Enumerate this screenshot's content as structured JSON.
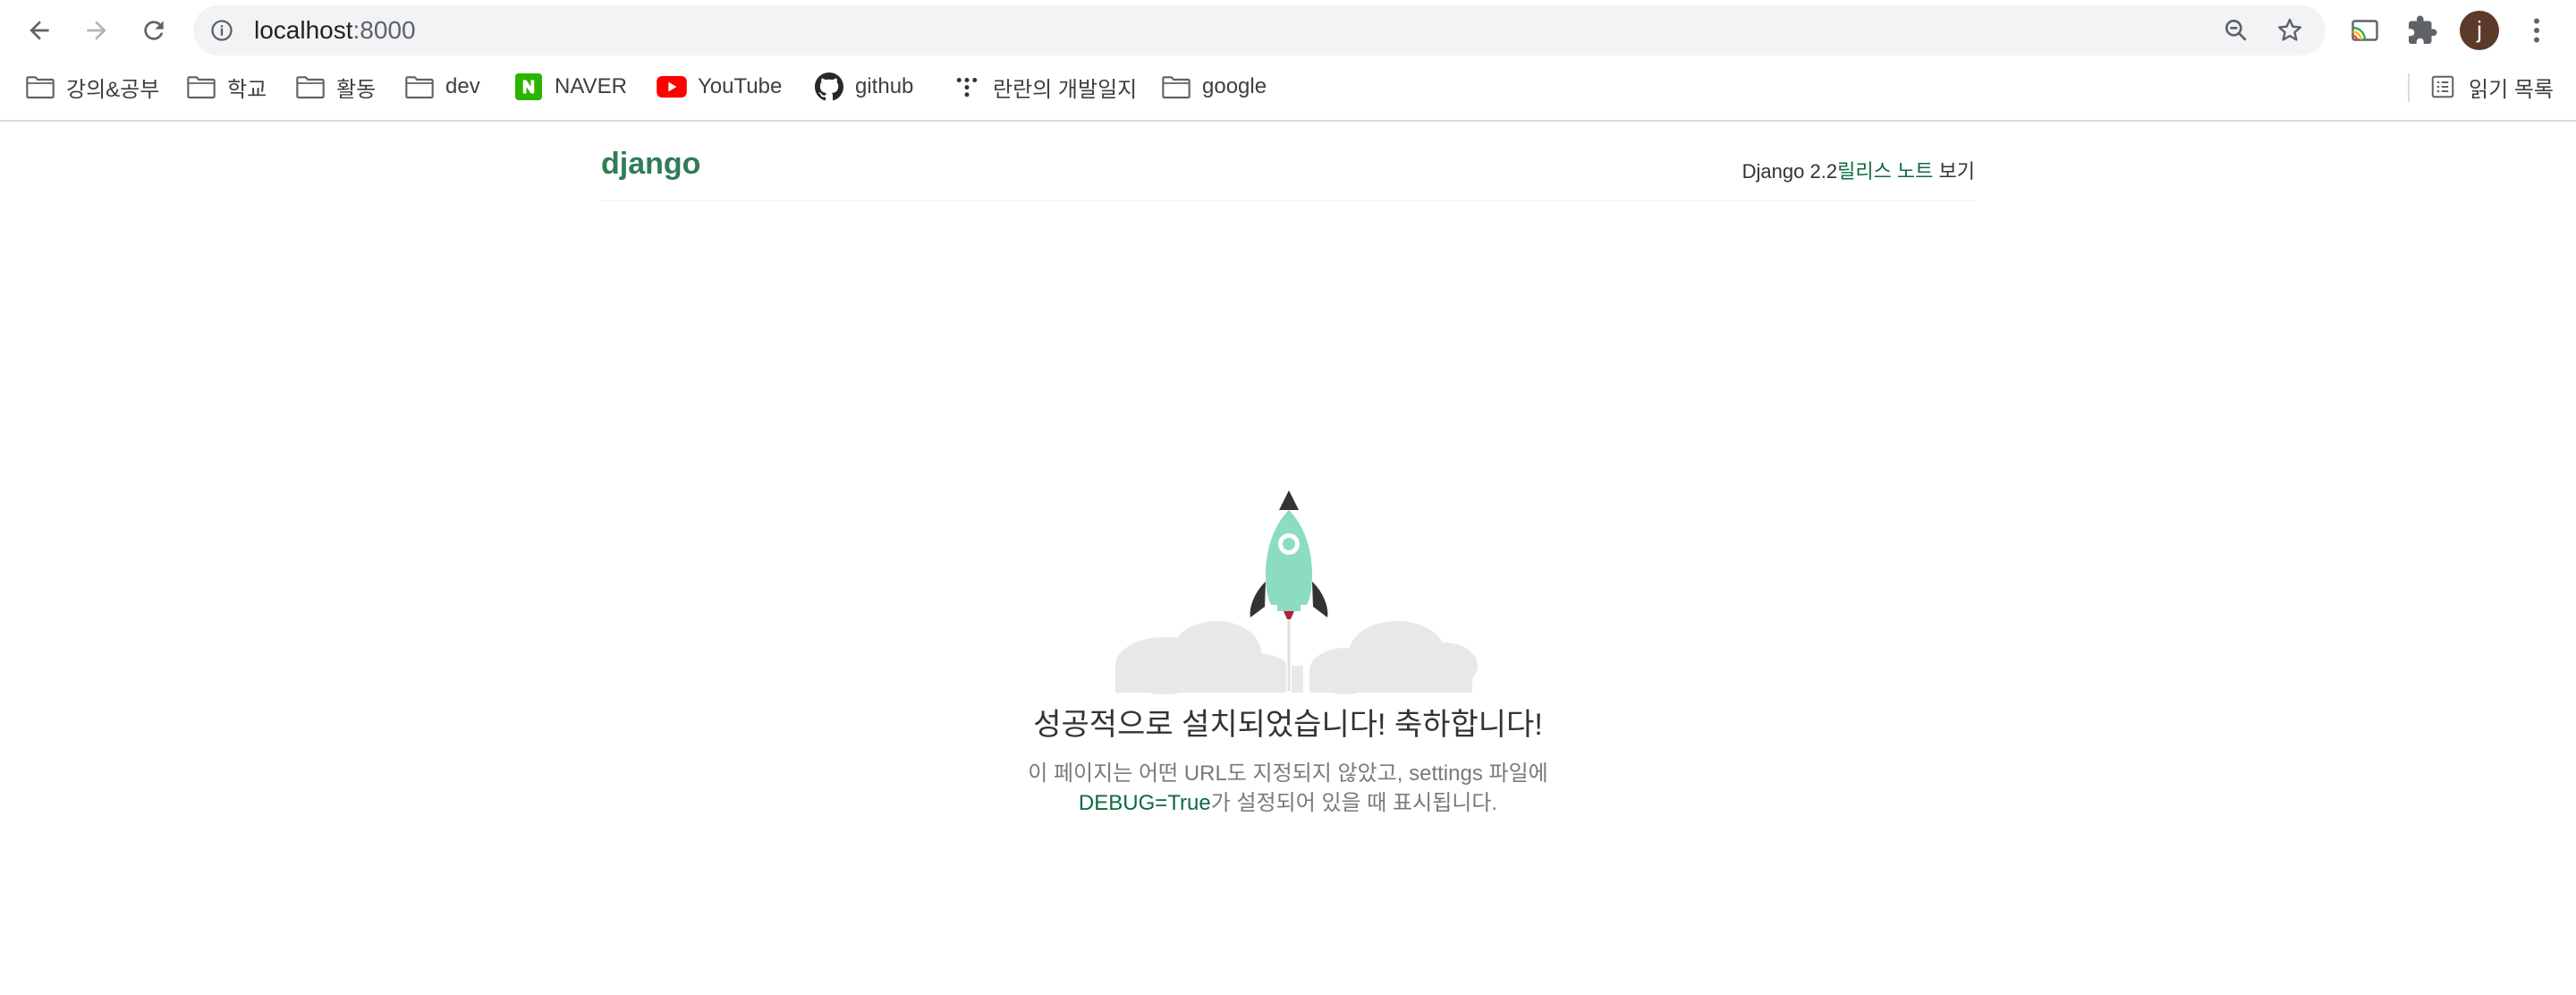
{
  "browser": {
    "url_host": "localhost",
    "url_port": ":8000",
    "avatar_initial": "j",
    "nav_icons": [
      "back-icon",
      "forward-icon",
      "reload-icon"
    ],
    "omnibox_icons": [
      "info-icon",
      "zoom-icon",
      "star-icon"
    ],
    "toolbar_icons": [
      "cast-icon",
      "extensions-icon",
      "menu-icon"
    ]
  },
  "bookmarks": {
    "items": [
      {
        "label": "강의&공부",
        "icon": "folder-icon"
      },
      {
        "label": "학교",
        "icon": "folder-icon"
      },
      {
        "label": "활동",
        "icon": "folder-icon"
      },
      {
        "label": "dev",
        "icon": "folder-icon"
      },
      {
        "label": "NAVER",
        "icon": "naver-icon"
      },
      {
        "label": "YouTube",
        "icon": "youtube-icon"
      },
      {
        "label": "github",
        "icon": "github-icon"
      },
      {
        "label": "란란의 개발일지",
        "icon": "tistory-icon"
      },
      {
        "label": "google",
        "icon": "folder-icon"
      }
    ],
    "reading_list": "읽기 목록"
  },
  "page": {
    "logo": "django",
    "release_prefix": "Django 2.2",
    "release_link": "릴리스 노트",
    "release_suffix": " 보기",
    "title": "성공적으로 설치되었습니다! 축하합니다!",
    "sub_line1": "이 페이지는 어떤 URL도 지정되지 않았고, settings 파일에",
    "sub_debug": "DEBUG=True",
    "sub_line2_rest": "가 설정되어 있을 때 표시됩니다."
  },
  "colors": {
    "django_green": "#0c6b3f",
    "logo_green": "#2e7d57",
    "rocket_body": "#8cdcbf",
    "rocket_dark": "#333333",
    "cloud": "#e7e8ea"
  }
}
